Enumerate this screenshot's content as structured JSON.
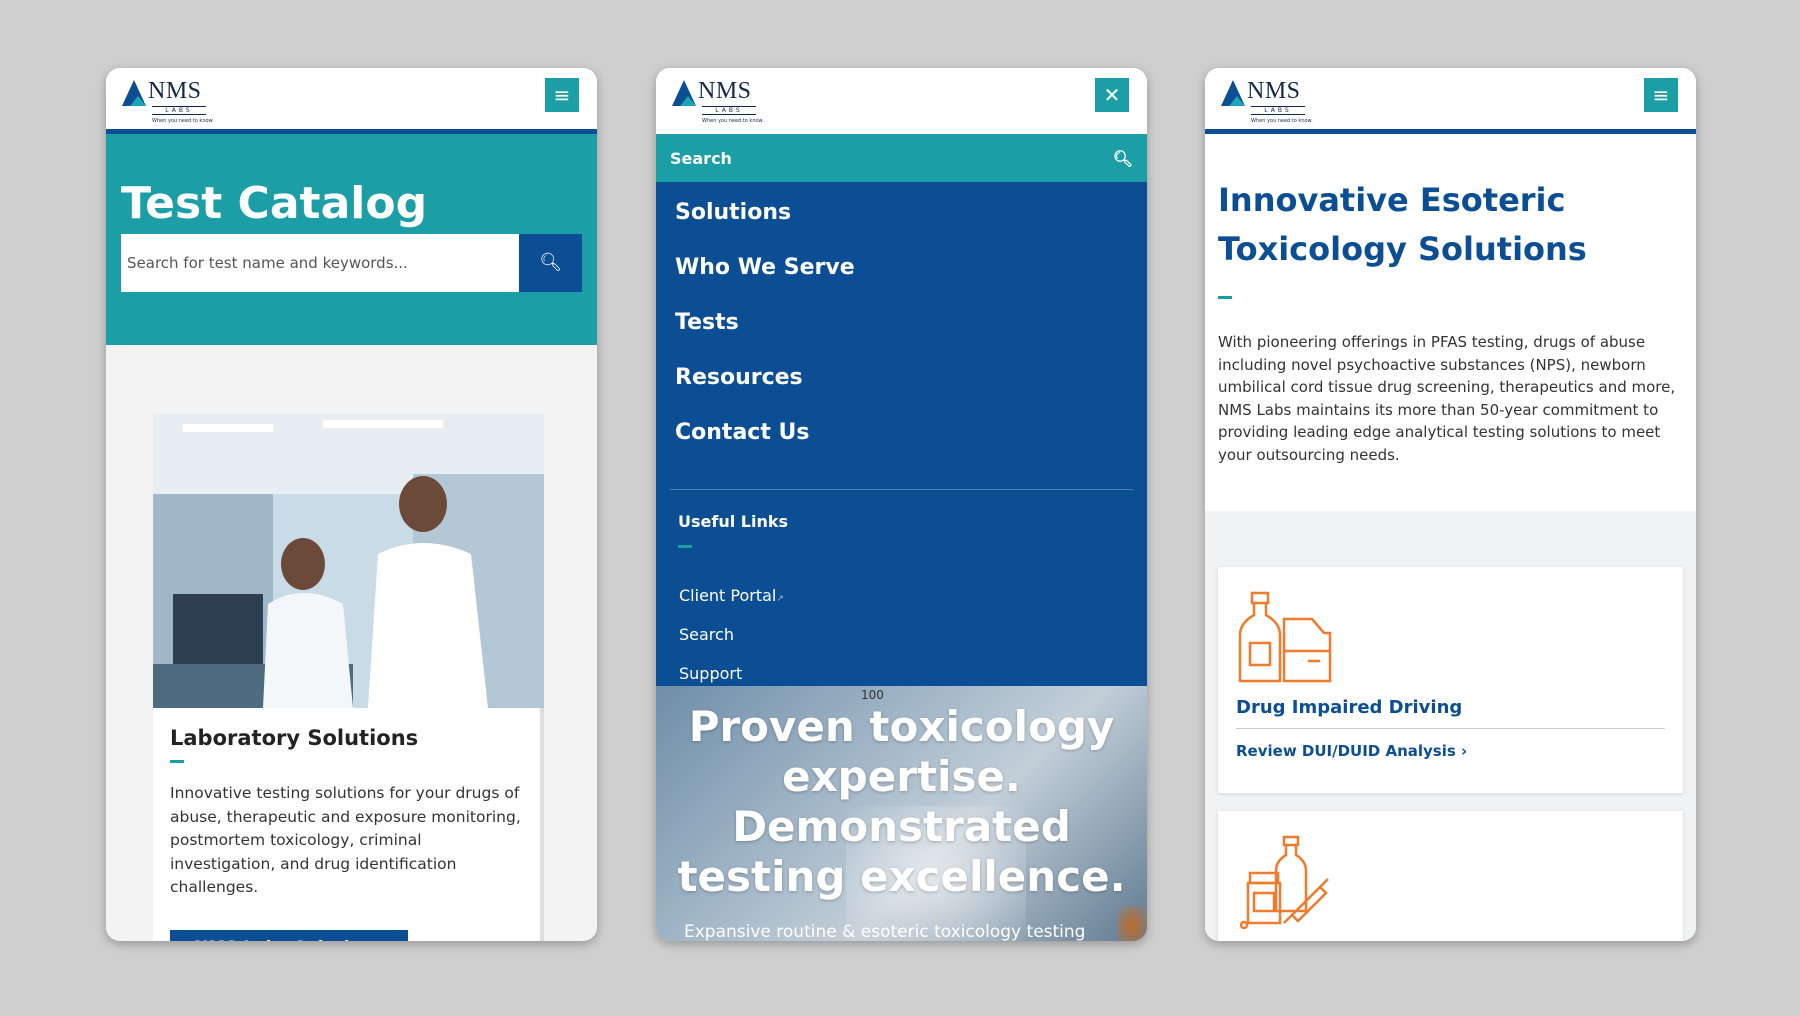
{
  "logo": {
    "name": "NMS",
    "sub": "LABS",
    "tagline": "When you need to know."
  },
  "phone1": {
    "catalog_title": "Test Catalog",
    "search_placeholder": "Search for test name and keywords...",
    "card": {
      "title": "Laboratory Solutions",
      "body": "Innovative testing solutions for your drugs of abuse, therapeutic and exposure monitoring, postmortem toxicology, criminal investigation, and drug identification challenges.",
      "button": "NMS Labs Solutions"
    }
  },
  "phone2": {
    "search_label": "Search",
    "nav": [
      "Solutions",
      "Who We Serve",
      "Tests",
      "Resources",
      "Contact Us"
    ],
    "useful_links_heading": "Useful Links",
    "useful_links": [
      "Client Portal",
      "Search",
      "Support"
    ],
    "hero_scale_label": "100",
    "hero_title": "Proven toxicology expertise. Demonstrated testing excellence.",
    "hero_sub": "Expansive routine & esoteric toxicology testing"
  },
  "phone3": {
    "title": "Innovative Esoteric Toxicology Solutions",
    "body": "With pioneering offerings in PFAS testing, drugs of abuse including novel psychoactive substances (NPS), newborn umbilical cord tissue drug screening, therapeutics and more, NMS Labs maintains its more than 50-year commitment to providing leading edge analytical testing solutions to meet your outsourcing needs.",
    "card1": {
      "title": "Drug Impaired Driving",
      "link": "Review DUI/DUID Analysis ›"
    }
  },
  "colors": {
    "teal": "#1b9ea6",
    "blue": "#0b4e93",
    "orange": "#f07b2c"
  },
  "icons": {
    "menu": "hamburger-icon",
    "close": "close-icon",
    "search": "search-icon",
    "external": "external-link-icon"
  }
}
